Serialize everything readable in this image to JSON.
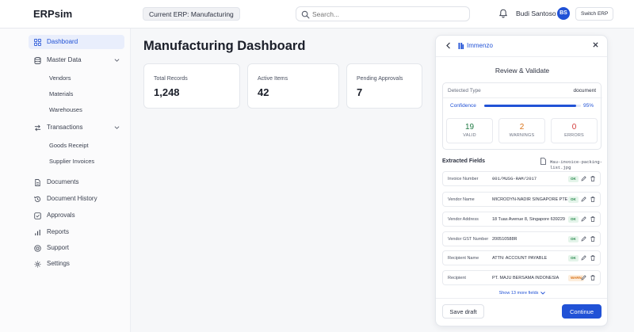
{
  "app": {
    "brand": "ERPsim",
    "current_erp": "Current ERP: Manufacturing"
  },
  "search": {
    "placeholder": "Search..."
  },
  "user": {
    "name": "Budi Santoso",
    "initials": "BS",
    "switch_label": "Switch ERP"
  },
  "sidebar": {
    "dashboard": "Dashboard",
    "master_data": "Master Data",
    "master_children": [
      "Vendors",
      "Materials",
      "Warehouses"
    ],
    "transactions": "Transactions",
    "transaction_children": [
      "Goods Receipt",
      "Supplier Invoices"
    ],
    "documents": "Documents",
    "document_history": "Document History",
    "approvals": "Approvals",
    "reports": "Reports",
    "support": "Support",
    "settings": "Settings"
  },
  "main": {
    "title": "Manufacturing Dashboard",
    "cards": [
      {
        "label": "Total Records",
        "value": "1,248"
      },
      {
        "label": "Active Items",
        "value": "42"
      },
      {
        "label": "Pending Approvals",
        "value": "7"
      }
    ]
  },
  "panel": {
    "logo": "Immenzo",
    "heading": "Review & Validate",
    "detected_type_label": "Detected Type",
    "detected_type_value": "document",
    "confidence_label": "Confidence",
    "confidence_value": "95%",
    "confidence_fraction": 0.95,
    "stats": [
      {
        "num": "19",
        "cap": "VALID",
        "color": "#1f7a43"
      },
      {
        "num": "2",
        "cap": "WARNINGS",
        "color": "#d9731a"
      },
      {
        "num": "0",
        "cap": "ERRORS",
        "color": "#d23b3b"
      }
    ],
    "fields_title": "Extracted Fields",
    "file_name": "Mau-invoice-packing-list.jpg",
    "fields": [
      {
        "label": "Invoice Number",
        "value": "001/MUSG-RAM/2017",
        "status": "OK"
      },
      {
        "label": "Vendor Name",
        "value": "MICRODYN-NADIR SINGAPORE PTE LTD",
        "status": "OK"
      },
      {
        "label": "Vendor Address",
        "value": "18 Tuas Avenue 8, Singapore 639229",
        "status": "OK"
      },
      {
        "label": "Vendor GST Number",
        "value": "200510588R",
        "status": "OK"
      },
      {
        "label": "Recipient Name",
        "value": "ATTN: ACCOUNT PAYABLE",
        "status": "OK"
      },
      {
        "label": "Recipient",
        "value": "PT. MAJU BERSAMA INDONESIA",
        "status": "WARN"
      }
    ],
    "show_more": "Show 13 more fields",
    "save_draft": "Save draft",
    "continue": "Continue"
  },
  "colors": {
    "accent": "#2152d6",
    "ok": "#2b8a4e",
    "warn": "#d9731a",
    "error": "#d23b3b"
  }
}
